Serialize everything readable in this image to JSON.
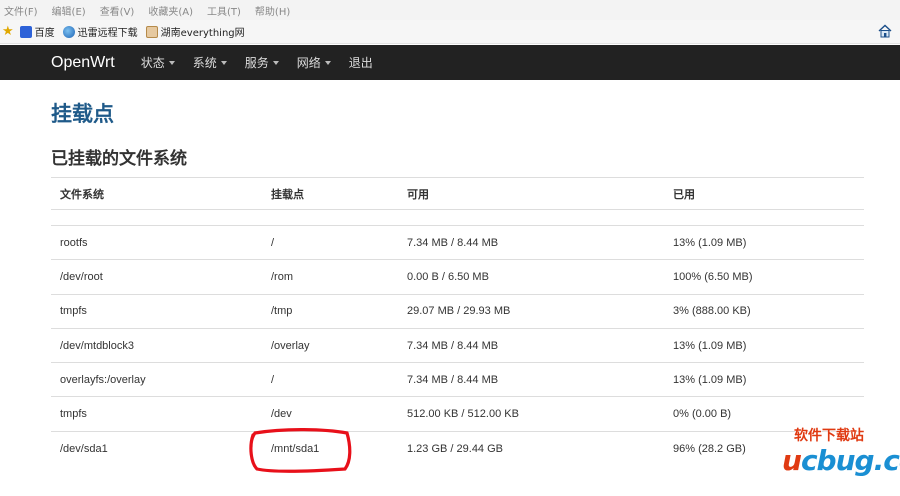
{
  "browser": {
    "menu": [
      "文件(F)",
      "编辑(E)",
      "查看(V)",
      "收藏夹(A)",
      "工具(T)",
      "帮助(H)"
    ],
    "favorites": [
      "百度",
      "迅雷远程下载",
      "湖南everything网"
    ]
  },
  "navbar": {
    "brand": "OpenWrt",
    "items": [
      "状态",
      "系统",
      "服务",
      "网络",
      "退出"
    ]
  },
  "page": {
    "title": "挂载点",
    "section": "已挂载的文件系统"
  },
  "table": {
    "headers": [
      "文件系统",
      "挂载点",
      "可用",
      "已用"
    ],
    "rows": [
      [
        "rootfs",
        "/",
        "7.34 MB / 8.44 MB",
        "13% (1.09 MB)"
      ],
      [
        "/dev/root",
        "/rom",
        "0.00 B / 6.50 MB",
        "100% (6.50 MB)"
      ],
      [
        "tmpfs",
        "/tmp",
        "29.07 MB / 29.93 MB",
        "3% (888.00 KB)"
      ],
      [
        "/dev/mtdblock3",
        "/overlay",
        "7.34 MB / 8.44 MB",
        "13% (1.09 MB)"
      ],
      [
        "overlayfs:/overlay",
        "/",
        "7.34 MB / 8.44 MB",
        "13% (1.09 MB)"
      ],
      [
        "tmpfs",
        "/dev",
        "512.00 KB / 512.00 KB",
        "0% (0.00 B)"
      ],
      [
        "/dev/sda1",
        "/mnt/sda1",
        "1.23 GB / 29.44 GB",
        "96% (28.2 GB)"
      ]
    ]
  },
  "watermark": {
    "top": "软件下载站",
    "u": "u",
    "rest": "cbug",
    "tld": ".cc"
  },
  "colors": {
    "navbar_bg": "#222222",
    "title": "#1f5a89",
    "annotation": "#e8101a"
  }
}
